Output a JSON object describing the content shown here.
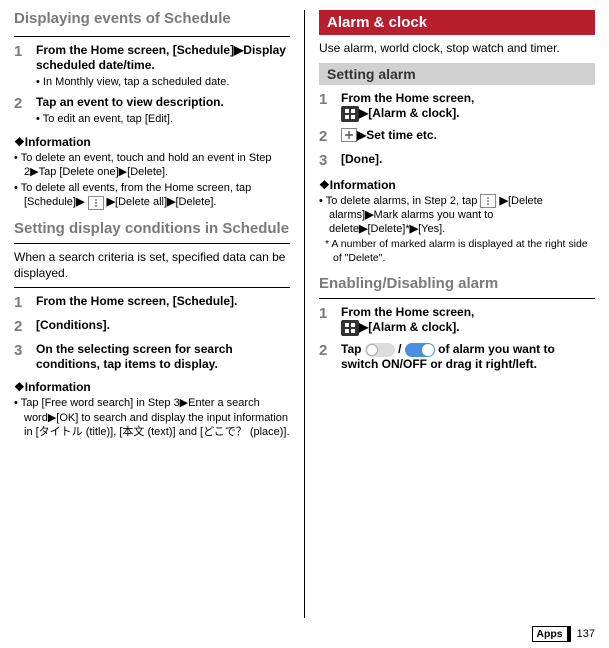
{
  "left": {
    "h1": "Displaying events of Schedule",
    "steps_a": [
      {
        "num": "1",
        "title_parts": [
          "From the Home screen, [",
          "Schedule",
          "]",
          "▶",
          "Display scheduled date/time."
        ],
        "bullets": [
          "In Monthly view, tap a scheduled date."
        ]
      },
      {
        "num": "2",
        "title_parts": [
          "Tap an event to view description."
        ],
        "bullets": [
          "To edit an event, tap [Edit]."
        ]
      }
    ],
    "info_a_title": "❖Information",
    "info_a": [
      "To delete an event, touch and hold an event in Step 2▶Tap [Delete one]▶[Delete].",
      "To delete all events, from the Home screen, tap [Schedule]▶ |menu| ▶[Delete all]▶[Delete]."
    ],
    "sub1": "Setting display conditions in Schedule",
    "intro1": "When a search criteria is set, specified data can be displayed.",
    "steps_b": [
      {
        "num": "1",
        "title": "From the Home screen, [Schedule]."
      },
      {
        "num": "2",
        "title": "[Conditions]."
      },
      {
        "num": "3",
        "title": "On the selecting screen for search conditions, tap items to display."
      }
    ],
    "info_b_title": "❖Information",
    "info_b": [
      "Tap [Free word search] in Step 3▶Enter a search word▶[OK] to search and display the input information in [タイトル (title)], [本文 (text)] and [どこで？ (place)]."
    ]
  },
  "right": {
    "h_red": "Alarm & clock",
    "intro": "Use alarm, world clock, stop watch and timer.",
    "h_grey": "Setting alarm",
    "steps_c": [
      {
        "num": "1",
        "title_pre": "From the Home screen, ",
        "title_post": "▶[Alarm & clock]."
      },
      {
        "num": "2",
        "title_post": "▶Set time etc."
      },
      {
        "num": "3",
        "title": "[Done]."
      }
    ],
    "info_c_title": "❖Information",
    "info_c": [
      "To delete alarms, in Step 2, tap |menu| ▶[Delete alarms]▶Mark alarms you want to delete▶[Delete]*▶[Yes]."
    ],
    "note_c": "* A number of marked alarm is displayed at the right side of \"Delete\".",
    "sub2": "Enabling/Disabling alarm",
    "steps_d": [
      {
        "num": "1",
        "title_pre": "From the Home screen, ",
        "title_post": "▶[Alarm & clock]."
      },
      {
        "num": "2",
        "title_pre": "Tap ",
        "title_mid": " / ",
        "title_post": " of alarm you want to switch ON/OFF or drag it right/left."
      }
    ]
  },
  "footer": {
    "label": "Apps",
    "page": "137"
  }
}
